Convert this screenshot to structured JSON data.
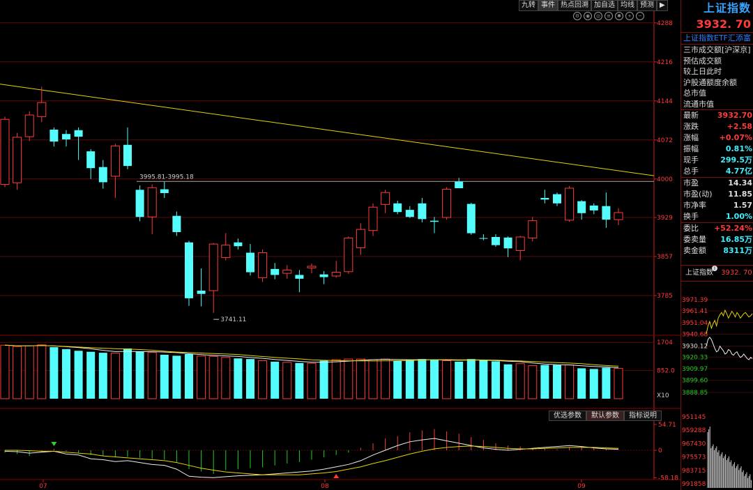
{
  "toolbar": {
    "items": [
      "九转",
      "事件",
      "热点回溯",
      "加自选",
      "均线",
      "预测"
    ],
    "active": 1,
    "icons": [
      "settings-icon",
      "eye-icon",
      "eye-alt-icon",
      "list-icon",
      "gear-icon",
      "zoom-in-icon",
      "zoom-out-icon"
    ]
  },
  "lower_tabs": {
    "items": [
      "优选参数",
      "默认参数",
      "指标说明"
    ],
    "active": 1
  },
  "chart_data": [
    {
      "type": "candlestick",
      "name": "price",
      "y_ticks": [
        "4288",
        "4216",
        "4144",
        "4072",
        "4000",
        "3929",
        "3857",
        "3785"
      ],
      "ylim": [
        3713,
        4307
      ],
      "x_ticks": [
        "07",
        "08",
        "09"
      ],
      "annotations": {
        "range_label": "3995.81-3995.18",
        "range_value": 3995.5,
        "low_label": "3741.11",
        "low_value": 3741.11
      },
      "trend_line": {
        "start": 4175,
        "end": 4006
      },
      "candles": [
        [
          3990,
          4110,
          4115,
          3985
        ],
        [
          3993,
          4077,
          4085,
          3980
        ],
        [
          4078,
          4118,
          4125,
          4070
        ],
        [
          4115,
          4141,
          4170,
          4105
        ],
        [
          4091,
          4069,
          4095,
          4060
        ],
        [
          4083,
          4073,
          4090,
          4060
        ],
        [
          4090,
          4078,
          4095,
          4035
        ],
        [
          4051,
          4020,
          4055,
          4000
        ],
        [
          4022,
          3994,
          4035,
          3982
        ],
        [
          4005,
          4061,
          4065,
          3965
        ],
        [
          4063,
          4024,
          4095,
          4018
        ],
        [
          3980,
          3930,
          3988,
          3922
        ],
        [
          3930,
          3984,
          3990,
          3898
        ],
        [
          3981,
          3974,
          3995,
          3965
        ],
        [
          3932,
          3902,
          3940,
          3895
        ],
        [
          3883,
          3780,
          3886,
          3766
        ],
        [
          3794,
          3788,
          3835,
          3765
        ],
        [
          3794,
          3880,
          3882,
          3753
        ],
        [
          3855,
          3878,
          3900,
          3850
        ],
        [
          3883,
          3876,
          3890,
          3870
        ],
        [
          3864,
          3828,
          3880,
          3822
        ],
        [
          3818,
          3864,
          3870,
          3810
        ],
        [
          3834,
          3823,
          3845,
          3815
        ],
        [
          3826,
          3832,
          3841,
          3816
        ],
        [
          3823,
          3816,
          3832,
          3791
        ],
        [
          3836,
          3839,
          3844,
          3826
        ],
        [
          3824,
          3819,
          3830,
          3806
        ],
        [
          3821,
          3828,
          3849,
          3818
        ],
        [
          3829,
          3891,
          3894,
          3825
        ],
        [
          3873,
          3907,
          3918,
          3860
        ],
        [
          3905,
          3948,
          3955,
          3895
        ],
        [
          3953,
          3975,
          3980,
          3937
        ],
        [
          3955,
          3939,
          3960,
          3935
        ],
        [
          3943,
          3930,
          3950,
          3928
        ],
        [
          3955,
          3926,
          3965,
          3920
        ],
        [
          3923,
          3921,
          3930,
          3900
        ],
        [
          3929,
          3981,
          3985,
          3925
        ],
        [
          3995,
          3983,
          4002,
          3985
        ],
        [
          3954,
          3900,
          3956,
          3897
        ],
        [
          3891,
          3890,
          3898,
          3887
        ],
        [
          3893,
          3878,
          3898,
          3875
        ],
        [
          3892,
          3872,
          3894,
          3856
        ],
        [
          3868,
          3893,
          3895,
          3850
        ],
        [
          3891,
          3923,
          3930,
          3885
        ],
        [
          3965,
          3962,
          3980,
          3955
        ],
        [
          3972,
          3955,
          3975,
          3950
        ],
        [
          3924,
          3983,
          3987,
          3921
        ],
        [
          3959,
          3937,
          3961,
          3925
        ],
        [
          3951,
          3942,
          3955,
          3935
        ],
        [
          3950,
          3925,
          3975,
          3910
        ],
        [
          3925,
          3938,
          3946,
          3915
        ]
      ]
    },
    {
      "type": "bar",
      "name": "volume",
      "y_ticks": [
        "1704",
        "852.0"
      ],
      "unit_label": "X10",
      "ylim": [
        0,
        1730
      ],
      "values": [
        1620,
        1580,
        1600,
        1630,
        1560,
        1500,
        1450,
        1420,
        1390,
        1380,
        1520,
        1430,
        1400,
        1330,
        1300,
        1350,
        1290,
        1280,
        1250,
        1220,
        1200,
        1150,
        1120,
        1100,
        1080,
        1070,
        1150,
        1180,
        1200,
        1200,
        1180,
        1200,
        1150,
        1170,
        1200,
        1180,
        1150,
        1120,
        1200,
        1180,
        1130,
        1040,
        1060,
        1000,
        1020,
        1020,
        1020,
        920,
        900,
        940,
        920
      ],
      "up": [
        true,
        true,
        true,
        true,
        false,
        false,
        false,
        false,
        false,
        true,
        false,
        false,
        true,
        false,
        false,
        false,
        true,
        true,
        true,
        false,
        false,
        true,
        false,
        true,
        false,
        true,
        false,
        true,
        true,
        true,
        true,
        true,
        false,
        false,
        false,
        false,
        true,
        false,
        false,
        false,
        false,
        false,
        true,
        true,
        false,
        false,
        true,
        false,
        false,
        false,
        true
      ]
    },
    {
      "type": "macd",
      "name": "macd",
      "y_ticks": [
        "54.71",
        "0",
        "-58.18"
      ],
      "ylim": [
        -62,
        62
      ],
      "histogram": [
        -5,
        -8,
        -12,
        -3,
        3,
        -2,
        -5,
        -10,
        -12,
        -15,
        -14,
        -16,
        -18,
        -20,
        -25,
        -40,
        -45,
        -50,
        -42,
        -40,
        -38,
        -36,
        -32,
        -28,
        -25,
        -20,
        -15,
        -10,
        -5,
        5,
        15,
        25,
        30,
        38,
        42,
        45,
        40,
        35,
        28,
        22,
        15,
        10,
        8,
        5,
        3,
        2,
        6,
        8,
        5,
        3,
        1
      ],
      "dif": [
        -2,
        -3,
        -6,
        -4,
        -2,
        -8,
        -10,
        -18,
        -20,
        -24,
        -22,
        -26,
        -30,
        -32,
        -40,
        -55,
        -57,
        -58,
        -56,
        -54,
        -53,
        -52,
        -50,
        -48,
        -46,
        -44,
        -40,
        -35,
        -30,
        -22,
        -10,
        0,
        10,
        18,
        22,
        25,
        20,
        15,
        10,
        5,
        2,
        0,
        2,
        4,
        6,
        8,
        10,
        8,
        5,
        3,
        2
      ],
      "dea": [
        0,
        0,
        -1,
        -2,
        -2,
        -4,
        -6,
        -8,
        -12,
        -14,
        -16,
        -18,
        -20,
        -22,
        -26,
        -32,
        -38,
        -42,
        -46,
        -48,
        -50,
        -52,
        -52,
        -52,
        -52,
        -50,
        -48,
        -45,
        -40,
        -35,
        -28,
        -22,
        -15,
        -8,
        -2,
        3,
        6,
        8,
        9,
        8,
        6,
        4,
        3,
        3,
        4,
        5,
        6,
        6,
        6,
        5,
        4
      ]
    },
    {
      "type": "line",
      "name": "intraday",
      "y_ticks": [
        "3971.39",
        "3961.41",
        "3951.04",
        "3940.68",
        "3930.12",
        "3920.33",
        "3909.97",
        "3899.60",
        "3888.85"
      ],
      "volume_ticks": [
        "951145",
        "959288",
        "967430",
        "975573",
        "983715",
        "991858"
      ],
      "header_title": "上证指数",
      "header_value": "3932. 70",
      "price": [
        3941,
        3948,
        3952,
        3946,
        3950,
        3953,
        3948,
        3955,
        3958,
        3960,
        3957,
        3962,
        3959,
        3955,
        3958,
        3961,
        3959,
        3956,
        3960,
        3958,
        3955,
        3957,
        3959,
        3960,
        3958,
        3956,
        3957,
        3959
      ],
      "avg": [
        3930,
        3936,
        3938,
        3936,
        3932,
        3928,
        3925,
        3926,
        3930,
        3928,
        3926,
        3923,
        3924,
        3927,
        3926,
        3923,
        3922,
        3924,
        3925,
        3922,
        3920,
        3921,
        3923,
        3921,
        3919,
        3918,
        3920,
        3919
      ]
    }
  ],
  "panel": {
    "title": "上证指数",
    "price": "3932. 70",
    "etf_label": "上证指数ETF汇添富",
    "info_lines": [
      "三市成交额[沪深京]",
      "预估成交额",
      "较上日此时",
      "沪股通额度余额",
      "总市值",
      "流通市值"
    ],
    "quotes": [
      {
        "k": "最新",
        "v": "3932.70",
        "c": "red"
      },
      {
        "k": "涨跌",
        "v": "+2.58",
        "c": "red"
      },
      {
        "k": "涨幅",
        "v": "+0.07%",
        "c": "red"
      },
      {
        "k": "振幅",
        "v": "0.81%",
        "c": "cyan"
      },
      {
        "k": "现手",
        "v": "299.5万",
        "c": "cyan"
      },
      {
        "k": "总手",
        "v": "4.77亿",
        "c": "cyan"
      }
    ],
    "valuation": [
      {
        "k": "市盈",
        "v": "14.34",
        "c": "white"
      },
      {
        "k": "市盈(动)",
        "v": "11.85",
        "c": "white"
      },
      {
        "k": "市净率",
        "v": "1.57",
        "c": "white"
      },
      {
        "k": "换手",
        "v": "1.00%",
        "c": "cyan"
      }
    ],
    "orders": [
      {
        "k": "委比",
        "v": "+52.24%",
        "c": "red"
      },
      {
        "k": "委卖量",
        "v": "16.85万",
        "c": "cyan"
      },
      {
        "k": "卖金额",
        "v": "8311万",
        "c": "cyan"
      }
    ],
    "mini_title": "上证指数",
    "mini_value": "3932. 70"
  }
}
